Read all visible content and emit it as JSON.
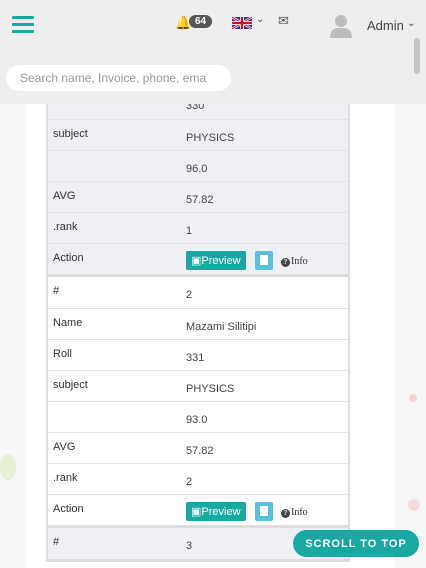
{
  "header": {
    "notification_count": "64",
    "mail_icon": "envelope-icon",
    "user_name": "Admin",
    "search_placeholder": "Search name, Invoice, phone, ema"
  },
  "records": [
    {
      "rows": [
        {
          "label": "",
          "value": "330"
        },
        {
          "label": "subject",
          "value": "PHYSICS"
        },
        {
          "label": "",
          "value": "96.0"
        },
        {
          "label": "AVG",
          "value": "57.82"
        },
        {
          "label": ".rank",
          "value": "1"
        }
      ],
      "action_label": "Action",
      "preview_label": "Preview",
      "info_label": "Info"
    },
    {
      "rows": [
        {
          "label": "#",
          "value": "2"
        },
        {
          "label": "Name",
          "value": "Mazami Silitipi"
        },
        {
          "label": "Roll",
          "value": "331"
        },
        {
          "label": "subject",
          "value": "PHYSICS"
        },
        {
          "label": "",
          "value": "93.0"
        },
        {
          "label": "AVG",
          "value": "57.82"
        },
        {
          "label": ".rank",
          "value": "2"
        }
      ],
      "action_label": "Action",
      "preview_label": "Preview",
      "info_label": "Info"
    },
    {
      "rows": [
        {
          "label": "#",
          "value": "3"
        }
      ]
    }
  ],
  "scroll_to_top_label": "SCROLL TO TOP",
  "colors": {
    "accent": "#1aa9a0",
    "doc_button": "#5bc0de"
  }
}
